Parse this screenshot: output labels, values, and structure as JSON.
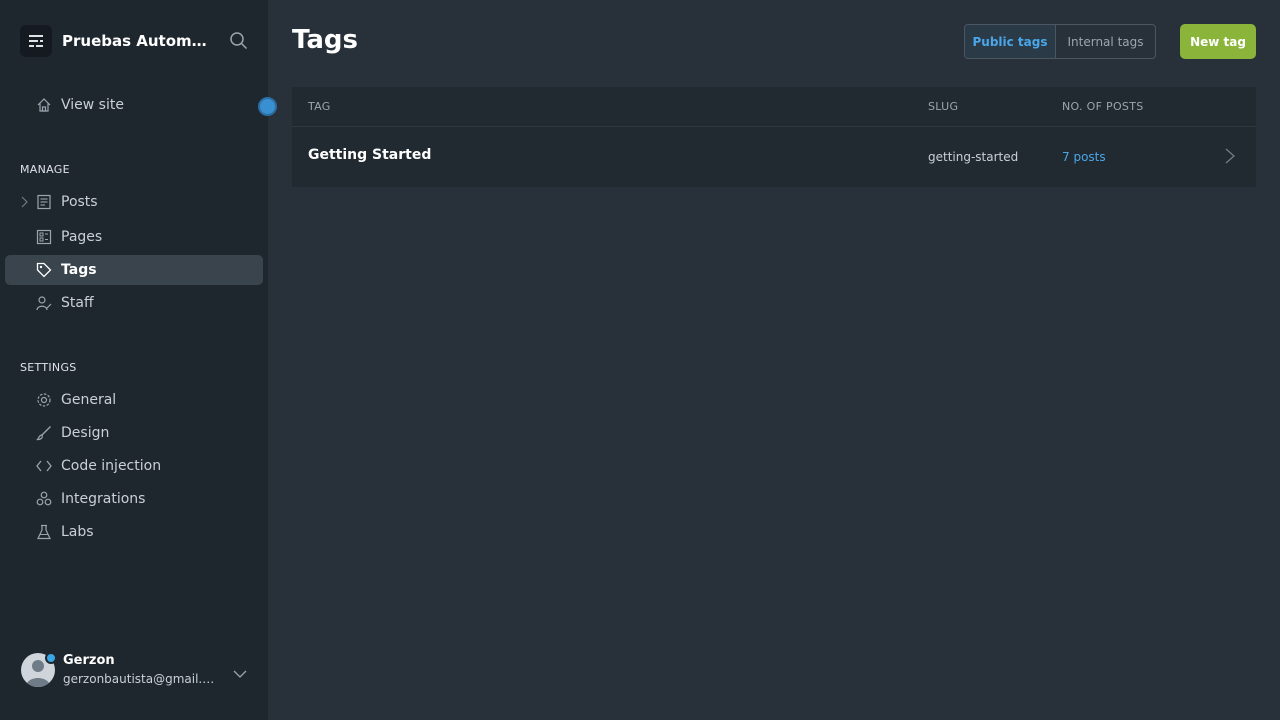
{
  "sidebar": {
    "site_title": "Pruebas Automatización",
    "view_site": "View site",
    "manage_label": "MANAGE",
    "settings_label": "SETTINGS",
    "manage_items": [
      {
        "label": "Posts",
        "icon": "posts-icon"
      },
      {
        "label": "Pages",
        "icon": "pages-icon"
      },
      {
        "label": "Tags",
        "icon": "tag-icon",
        "active": true
      },
      {
        "label": "Staff",
        "icon": "staff-icon"
      }
    ],
    "settings_items": [
      {
        "label": "General",
        "icon": "gear-icon"
      },
      {
        "label": "Design",
        "icon": "brush-icon"
      },
      {
        "label": "Code injection",
        "icon": "code-icon"
      },
      {
        "label": "Integrations",
        "icon": "integrations-icon"
      },
      {
        "label": "Labs",
        "icon": "flask-icon"
      }
    ],
    "user": {
      "name": "Gerzon",
      "email": "gerzonbautista@gmail.com"
    }
  },
  "main": {
    "title": "Tags",
    "filters": {
      "public": "Public tags",
      "internal": "Internal tags",
      "selected": "Public tags"
    },
    "new_button": "New tag",
    "table": {
      "columns": {
        "tag": "TAG",
        "slug": "SLUG",
        "posts": "NO. OF POSTS"
      },
      "rows": [
        {
          "name": "Getting Started",
          "slug": "getting-started",
          "posts": "7 posts"
        }
      ]
    }
  },
  "colors": {
    "accent_blue": "#4aa6e8",
    "new_button_green": "#8ab53a",
    "sidebar_bg": "#1f272e",
    "main_bg": "#28313a"
  }
}
